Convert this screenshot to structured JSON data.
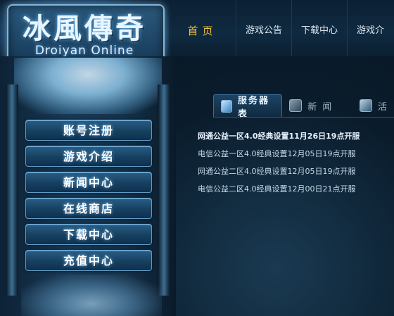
{
  "logo": {
    "title_cn": "冰風傳奇",
    "title_en": "Droiyan Online"
  },
  "nav": {
    "items": [
      "首页",
      "游戏公告",
      "下载中心",
      "游戏介"
    ]
  },
  "sidebar": {
    "menu": [
      "账号注册",
      "游戏介绍",
      "新闻中心",
      "在线商店",
      "下载中心",
      "充值中心"
    ]
  },
  "tabs": {
    "items": [
      "服务器表",
      "新闻",
      "活"
    ]
  },
  "news": {
    "items": [
      "网通公益一区4.0经典设置11月26日19点开服",
      "电信公益一区4.0经典设置12月05日19点开服",
      "网通公益二区4.0经典设置12月05日19点开服",
      "电信公益二区4.0经典设置12月00日21点开服"
    ]
  },
  "colors": {
    "nav_active": "#f0c040",
    "accent": "#3b83c0"
  }
}
